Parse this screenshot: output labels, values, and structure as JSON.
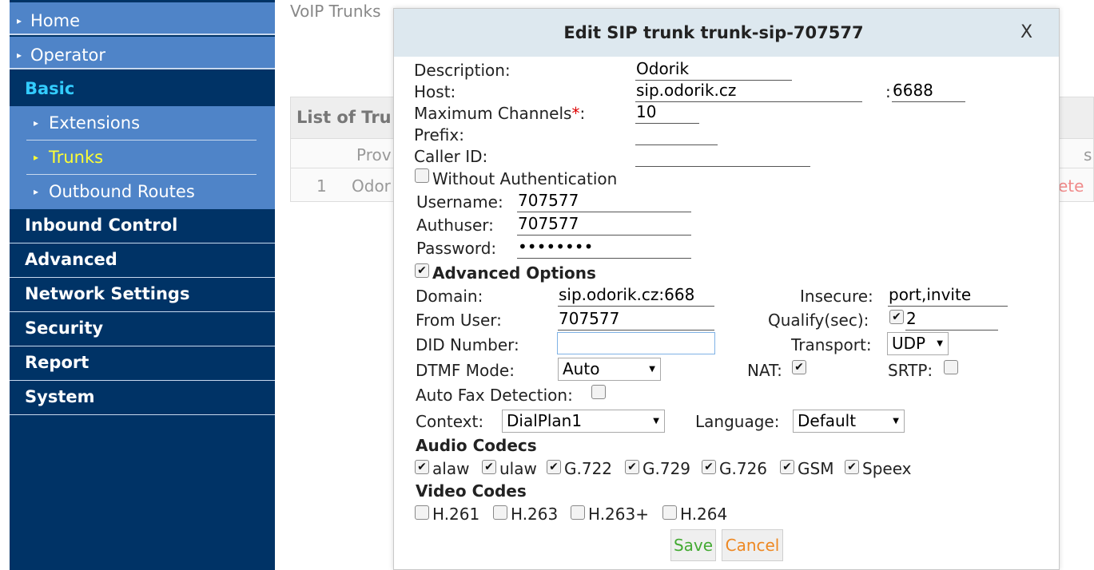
{
  "sidebar": {
    "home": "Home",
    "operator": "Operator",
    "basic": "Basic",
    "extensions": "Extensions",
    "trunks": "Trunks",
    "outbound_routes": "Outbound Routes",
    "inbound_control": "Inbound Control",
    "advanced": "Advanced",
    "network_settings": "Network Settings",
    "security": "Security",
    "report": "Report",
    "system": "System"
  },
  "background": {
    "page_title": "VoIP Trunks",
    "panel_title": "List of Tru",
    "col_provider": "Prov",
    "col_right": "s",
    "row_index": "1",
    "row_name": "Odor",
    "row_action": "ete"
  },
  "modal": {
    "title": "Edit SIP trunk trunk-sip-707577",
    "close": "X",
    "labels": {
      "description": "Description:",
      "host": "Host:",
      "max_channels": "Maximum Channels",
      "required": "*",
      "max_channels_colon": ":",
      "prefix": "Prefix:",
      "caller_id": "Caller ID:",
      "without_auth": "Without Authentication",
      "username": "Username:",
      "authuser": "Authuser:",
      "password": "Password:",
      "advanced_options": "Advanced Options",
      "domain": "Domain:",
      "insecure": "Insecure:",
      "from_user": "From User:",
      "qualify": "Qualify(sec):",
      "did_number": "DID Number:",
      "transport": "Transport:",
      "dtmf_mode": "DTMF Mode:",
      "nat": "NAT:",
      "srtp": "SRTP:",
      "auto_fax": "Auto Fax Detection:",
      "context": "Context:",
      "language": "Language:",
      "audio_codecs": "Audio Codecs",
      "video_codes": "Video Codes",
      "host_port_sep": ":"
    },
    "values": {
      "description": "Odorik",
      "host": "sip.odorik.cz",
      "port": "6688",
      "max_channels": "10",
      "prefix": "",
      "caller_id": "",
      "username": "707577",
      "authuser": "707577",
      "password": "••••••••",
      "domain": "sip.odorik.cz:668",
      "insecure": "port,invite",
      "from_user": "707577",
      "qualify": "2",
      "did_number": "",
      "transport": "UDP",
      "dtmf_mode": "Auto",
      "context": "DialPlan1",
      "language": "Default"
    },
    "checks": {
      "without_auth": false,
      "advanced_options": true,
      "qualify": true,
      "nat": true,
      "srtp": false,
      "auto_fax": false
    },
    "audio_codecs": [
      {
        "label": "alaw",
        "checked": true
      },
      {
        "label": "ulaw",
        "checked": true
      },
      {
        "label": "G.722",
        "checked": true
      },
      {
        "label": "G.729",
        "checked": true
      },
      {
        "label": "G.726",
        "checked": true
      },
      {
        "label": "GSM",
        "checked": true
      },
      {
        "label": "Speex",
        "checked": true
      }
    ],
    "video_codecs": [
      {
        "label": "H.261",
        "checked": false
      },
      {
        "label": "H.263",
        "checked": false
      },
      {
        "label": "H.263+",
        "checked": false
      },
      {
        "label": "H.264",
        "checked": false
      }
    ],
    "buttons": {
      "save": "Save",
      "cancel": "Cancel"
    }
  },
  "colors": {
    "sidebar_bg": "#003366",
    "sidebar_sub_bg": "#4f84c8",
    "basic_text": "#33ccff",
    "active_sub_text": "#ffff33",
    "save_text": "#44aa33",
    "cancel_text": "#ee8822",
    "modal_header_bg": "#dde8ef"
  }
}
